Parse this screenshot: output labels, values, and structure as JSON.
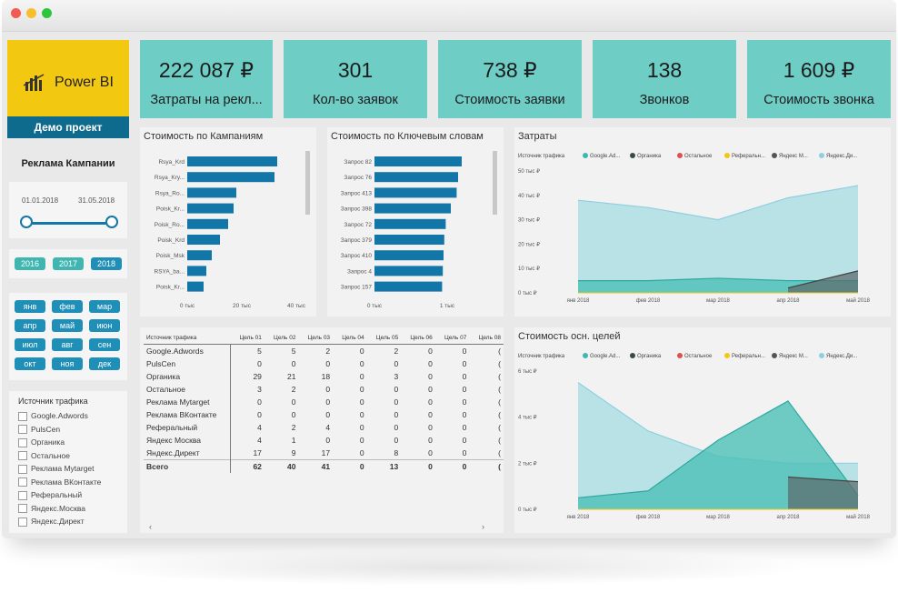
{
  "window": {
    "dots": [
      "#f25a52",
      "#f7bf2c",
      "#2dc53d"
    ]
  },
  "logo": {
    "text": "Power BI"
  },
  "project": {
    "label": "Демо проект"
  },
  "campaign_title": "Реклама Кампании",
  "date_range": {
    "start": "01.01.2018",
    "end": "31.05.2018"
  },
  "years": [
    "2016",
    "2017",
    "2018"
  ],
  "months": [
    "янв",
    "фев",
    "мар",
    "апр",
    "май",
    "июн",
    "июл",
    "авг",
    "сен",
    "окт",
    "ноя",
    "дек"
  ],
  "traffic_filter": {
    "title": "Источник трафика",
    "items": [
      "Google.Adwords",
      "PulsCen",
      "Органика",
      "Остальное",
      "Реклама Mytarget",
      "Реклама ВКонтакте",
      "Реферальный",
      "Яндекс.Москва",
      "Яндекс.Директ"
    ]
  },
  "kpis": [
    {
      "value": "222 087 ₽",
      "label": "Затраты на рекл..."
    },
    {
      "value": "301",
      "label": "Кол-во заявок"
    },
    {
      "value": "738 ₽",
      "label": "Стоимость заявки"
    },
    {
      "value": "138",
      "label": "Звонков"
    },
    {
      "value": "1 609 ₽",
      "label": "Стоимость звонка"
    }
  ],
  "colors": {
    "teal": "#6ecdc5",
    "bar": "#1277a8",
    "darkblue": "#0e6b8e",
    "pill_year": "#3fb6b0",
    "pill_month": "#1f8fb8"
  },
  "chart_data": [
    {
      "type": "bar",
      "title": "Стоимость по Кампаниям",
      "categories": [
        "Rsya_Krd",
        "Rsya_Kry...",
        "Rsya_Ro...",
        "Poisk_Kr...",
        "Poisk_Ro...",
        "Poisk_Krd",
        "Poisk_Msk",
        "RSYA_ba...",
        "Poisk_Kr..."
      ],
      "values": [
        33000,
        32000,
        18000,
        17000,
        15000,
        12000,
        9000,
        7000,
        6000
      ],
      "xticks": [
        "0 тыс",
        "20 тыс",
        "40 тыс"
      ],
      "xlim": [
        0,
        40000
      ]
    },
    {
      "type": "bar",
      "title": "Стоимость по Ключевым словам",
      "categories": [
        "Запрос 82",
        "Запрос 76",
        "Запрос 413",
        "Запрос 398",
        "Запрос 72",
        "Запрос 379",
        "Запрос 410",
        "Запрос 4",
        "Запрос 157"
      ],
      "values": [
        1200,
        1150,
        1130,
        1050,
        980,
        960,
        950,
        940,
        930
      ],
      "xticks": [
        "0 тыс",
        "1 тыс"
      ],
      "xlim": [
        0,
        1500
      ]
    },
    {
      "type": "area",
      "title": "Затраты",
      "legend_title": "Источник трафика",
      "legend": [
        "Google.Ad...",
        "Органика",
        "Остальное",
        "Реферальн...",
        "Яндекс М...",
        "Яндекс.Ди..."
      ],
      "legend_colors": [
        "#3fb6b0",
        "#3a4a4a",
        "#e05050",
        "#f2c811",
        "#555555",
        "#8fcfe0"
      ],
      "x": [
        "янв 2018",
        "фев 2018",
        "мар 2018",
        "апр 2018",
        "май 2018"
      ],
      "yticks": [
        "0 тыс ₽",
        "10 тыс ₽",
        "20 тыс ₽",
        "30 тыс ₽",
        "40 тыс ₽",
        "50 тыс ₽"
      ],
      "ylim": [
        0,
        50
      ],
      "series": [
        {
          "name": "Яндекс.Ди...",
          "values": [
            38,
            35,
            30,
            39,
            44
          ]
        },
        {
          "name": "Google.Ad...",
          "values": [
            5,
            5,
            6,
            5,
            5
          ]
        },
        {
          "name": "Яндекс М...",
          "values": [
            null,
            null,
            null,
            2,
            9
          ]
        }
      ]
    },
    {
      "type": "area",
      "title": "Стоимость осн. целей",
      "legend_title": "Источник трафика",
      "legend": [
        "Google.Ad...",
        "Органика",
        "Остальное",
        "Реферальн...",
        "Яндекс М...",
        "Яндекс.Ди..."
      ],
      "legend_colors": [
        "#3fb6b0",
        "#3a4a4a",
        "#e05050",
        "#f2c811",
        "#555555",
        "#8fcfe0"
      ],
      "x": [
        "янв 2018",
        "фев 2018",
        "мар 2018",
        "апр 2018",
        "май 2018"
      ],
      "yticks": [
        "0 тыс ₽",
        "2 тыс ₽",
        "4 тыс ₽",
        "6 тыс ₽"
      ],
      "ylim": [
        0,
        6
      ],
      "series": [
        {
          "name": "Яндекс.Ди...",
          "values": [
            5.5,
            3.4,
            2.3,
            2.0,
            2.0
          ]
        },
        {
          "name": "Google.Ad...",
          "values": [
            0.5,
            0.8,
            3.0,
            4.7,
            0.6
          ]
        },
        {
          "name": "Яндекс М...",
          "values": [
            null,
            null,
            null,
            1.4,
            1.2
          ]
        }
      ]
    }
  ],
  "goals_table": {
    "headers": [
      "Источник трафика",
      "Цель 01",
      "Цель 02",
      "Цель 03",
      "Цель 04",
      "Цель 05",
      "Цель 06",
      "Цель 07",
      "Цель 08"
    ],
    "rows": [
      [
        "Google.Adwords",
        "5",
        "5",
        "2",
        "0",
        "2",
        "0",
        "0",
        "("
      ],
      [
        "PulsCen",
        "0",
        "0",
        "0",
        "0",
        "0",
        "0",
        "0",
        "("
      ],
      [
        "Органика",
        "29",
        "21",
        "18",
        "0",
        "3",
        "0",
        "0",
        "("
      ],
      [
        "Остальное",
        "3",
        "2",
        "0",
        "0",
        "0",
        "0",
        "0",
        "("
      ],
      [
        "Реклама Mytarget",
        "0",
        "0",
        "0",
        "0",
        "0",
        "0",
        "0",
        "("
      ],
      [
        "Реклама ВКонтакте",
        "0",
        "0",
        "0",
        "0",
        "0",
        "0",
        "0",
        "("
      ],
      [
        "Реферальный",
        "4",
        "2",
        "4",
        "0",
        "0",
        "0",
        "0",
        "("
      ],
      [
        "Яндекс Москва",
        "4",
        "1",
        "0",
        "0",
        "0",
        "0",
        "0",
        "("
      ],
      [
        "Яндекс.Директ",
        "17",
        "9",
        "17",
        "0",
        "8",
        "0",
        "0",
        "("
      ],
      [
        "Всего",
        "62",
        "40",
        "41",
        "0",
        "13",
        "0",
        "0",
        "("
      ]
    ]
  }
}
